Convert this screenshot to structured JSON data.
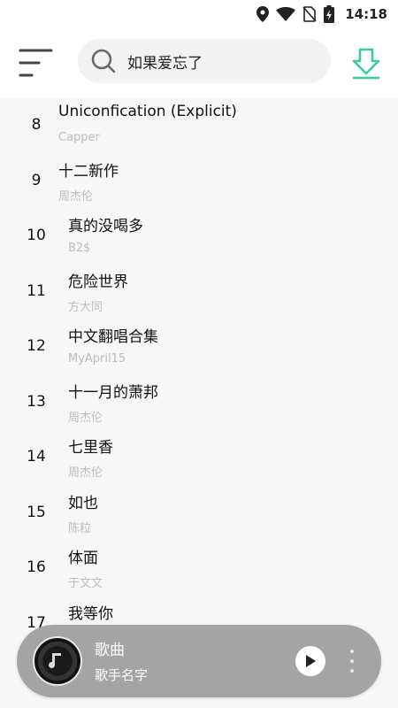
{
  "status_bar": {
    "time": "14:18",
    "icons": [
      "location-icon",
      "wifi-icon",
      "no-sim-icon",
      "battery-charging-icon"
    ]
  },
  "header": {
    "menu_icon": "menu-icon",
    "search": {
      "icon": "search-icon",
      "value": "如果爱忘了"
    },
    "download_icon": "download-icon",
    "accent_color": "#3cc8a0"
  },
  "songs": [
    {
      "index": "8",
      "title": "Uniconfication (Explicit)",
      "artist": "Capper"
    },
    {
      "index": "9",
      "title": "十二新作",
      "artist": "周杰伦"
    },
    {
      "index": "10",
      "title": "真的没喝多",
      "artist": "B2$"
    },
    {
      "index": "11",
      "title": "危险世界",
      "artist": "方大同"
    },
    {
      "index": "12",
      "title": "中文翻唱合集",
      "artist": "MyApril15"
    },
    {
      "index": "13",
      "title": "十一月的萧邦",
      "artist": "周杰伦"
    },
    {
      "index": "14",
      "title": "七里香",
      "artist": "周杰伦"
    },
    {
      "index": "15",
      "title": "如也",
      "artist": "陈粒"
    },
    {
      "index": "16",
      "title": "体面",
      "artist": "于文文"
    },
    {
      "index": "17",
      "title": "我等你",
      "artist": ""
    }
  ],
  "player": {
    "title": "歌曲",
    "artist": "歌手名字",
    "disc_icon": "music-note-icon",
    "play_icon": "play-icon",
    "more_icon": "more-vertical-icon",
    "background": "#a4a4a4"
  }
}
